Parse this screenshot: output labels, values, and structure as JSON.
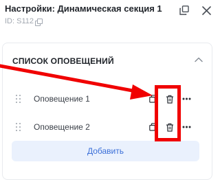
{
  "header": {
    "title": "Настройки: Динамическая секция 1",
    "id_text": "ID: S112"
  },
  "section": {
    "title": "СПИСОК ОПОВЕЩЕНИЙ"
  },
  "notifications": [
    {
      "label": "Оповещение 1"
    },
    {
      "label": "Оповещение 2"
    }
  ],
  "add_button": {
    "label": "Добавить"
  },
  "icons": {
    "popout": "popout-icon",
    "close": "close-icon",
    "collapse": "chevron-up-icon",
    "drag": "drag-handle-icon",
    "copy": "copy-icon",
    "delete": "trash-icon",
    "more": "more-horizontal-icon"
  },
  "colors": {
    "accent": "#3b6fd8",
    "add_button_bg": "#eaf1fd",
    "annotation": "#f00000"
  }
}
